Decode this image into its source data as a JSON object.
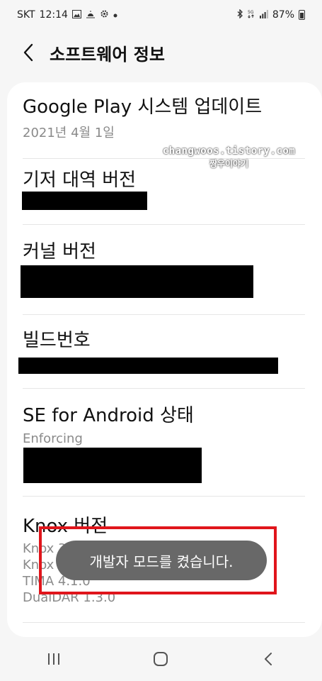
{
  "status_bar": {
    "carrier": "SKT",
    "time": "12:14",
    "battery_percent": "87%",
    "left_icons": [
      "image-icon",
      "weather-icon",
      "settings-icon",
      "dot-icon"
    ],
    "right_icons": [
      "bluetooth-icon",
      "5g-icon",
      "signal-icon",
      "battery-icon"
    ]
  },
  "header": {
    "title": "소프트웨어 정보"
  },
  "items": [
    {
      "title": "Google Play 시스템 업데이트",
      "sub": "2021년 4월 1일"
    },
    {
      "title": "기저 대역 버전"
    },
    {
      "title": "커널 버전"
    },
    {
      "title": "빌드번호"
    },
    {
      "title": "SE for Android 상태",
      "sub": "Enforcing"
    },
    {
      "title": "Knox 버전",
      "lines": [
        "Knox 3",
        "Knox A",
        "TIMA 4.1.0",
        "DualDAR 1.3.0"
      ]
    }
  ],
  "watermark": {
    "line1": "changwoos.tistory.com",
    "line2": "짱우이야기"
  },
  "toast": {
    "text": "개발자 모드를 켰습니다."
  },
  "colors": {
    "background": "#f6f6f6",
    "card": "#ffffff",
    "toast": "#686868",
    "highlight": "#e0151b"
  }
}
